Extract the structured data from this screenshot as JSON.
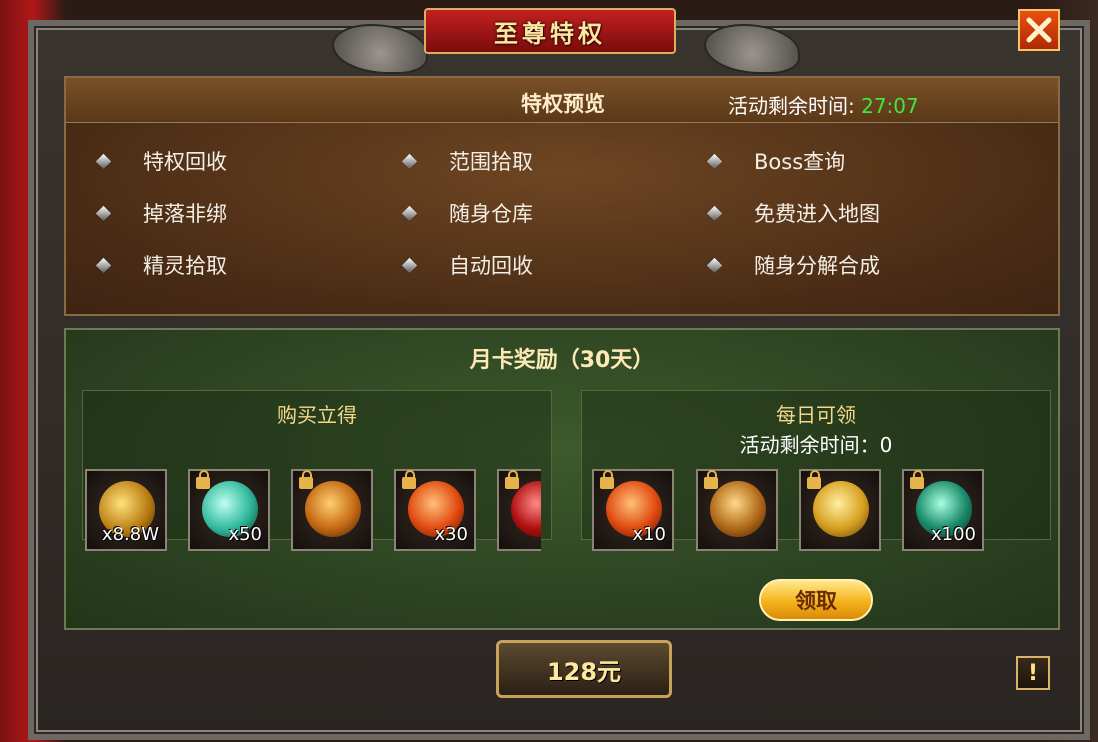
{
  "window": {
    "title": "至尊特权",
    "close_icon": "close-x-icon"
  },
  "preview": {
    "title": "特权预览",
    "timer_label": "活动剩余时间:",
    "timer_value": "27:07",
    "features": [
      "特权回收",
      "范围拾取",
      "Boss查询",
      "掉落非绑",
      "随身仓库",
      "免费进入地图",
      "精灵拾取",
      "自动回收",
      "随身分解合成"
    ]
  },
  "monthly_card": {
    "title": "月卡奖励（30天）",
    "instant": {
      "title": "购买立得",
      "items": [
        {
          "icon": "gold-dragon-icon",
          "qty": "x8.8W",
          "locked": false
        },
        {
          "icon": "crystal-icon",
          "qty": "x50",
          "locked": true
        },
        {
          "icon": "treasure-bag-icon",
          "qty": "",
          "locked": true
        },
        {
          "icon": "fire-orb-icon",
          "qty": "x30",
          "locked": true
        },
        {
          "icon": "red-orb-icon",
          "qty": "",
          "locked": true
        }
      ]
    },
    "daily": {
      "title": "每日可领",
      "timer_text": "活动剩余时间：0",
      "items": [
        {
          "icon": "fire-orb-icon",
          "qty": "x10",
          "locked": true
        },
        {
          "icon": "money-bag-icon",
          "qty": "",
          "locked": true
        },
        {
          "icon": "gold-coin-icon",
          "qty": "",
          "locked": true
        },
        {
          "icon": "guild-contribution-icon",
          "qty": "x100",
          "locked": true
        }
      ],
      "claim_label": "领取"
    }
  },
  "purchase": {
    "price_label": "128元"
  },
  "info_button": {
    "label": "!"
  },
  "colors": {
    "timer_green": "#3ee83a",
    "accent_gold": "#f5b21c",
    "title_red": "#c42020"
  }
}
